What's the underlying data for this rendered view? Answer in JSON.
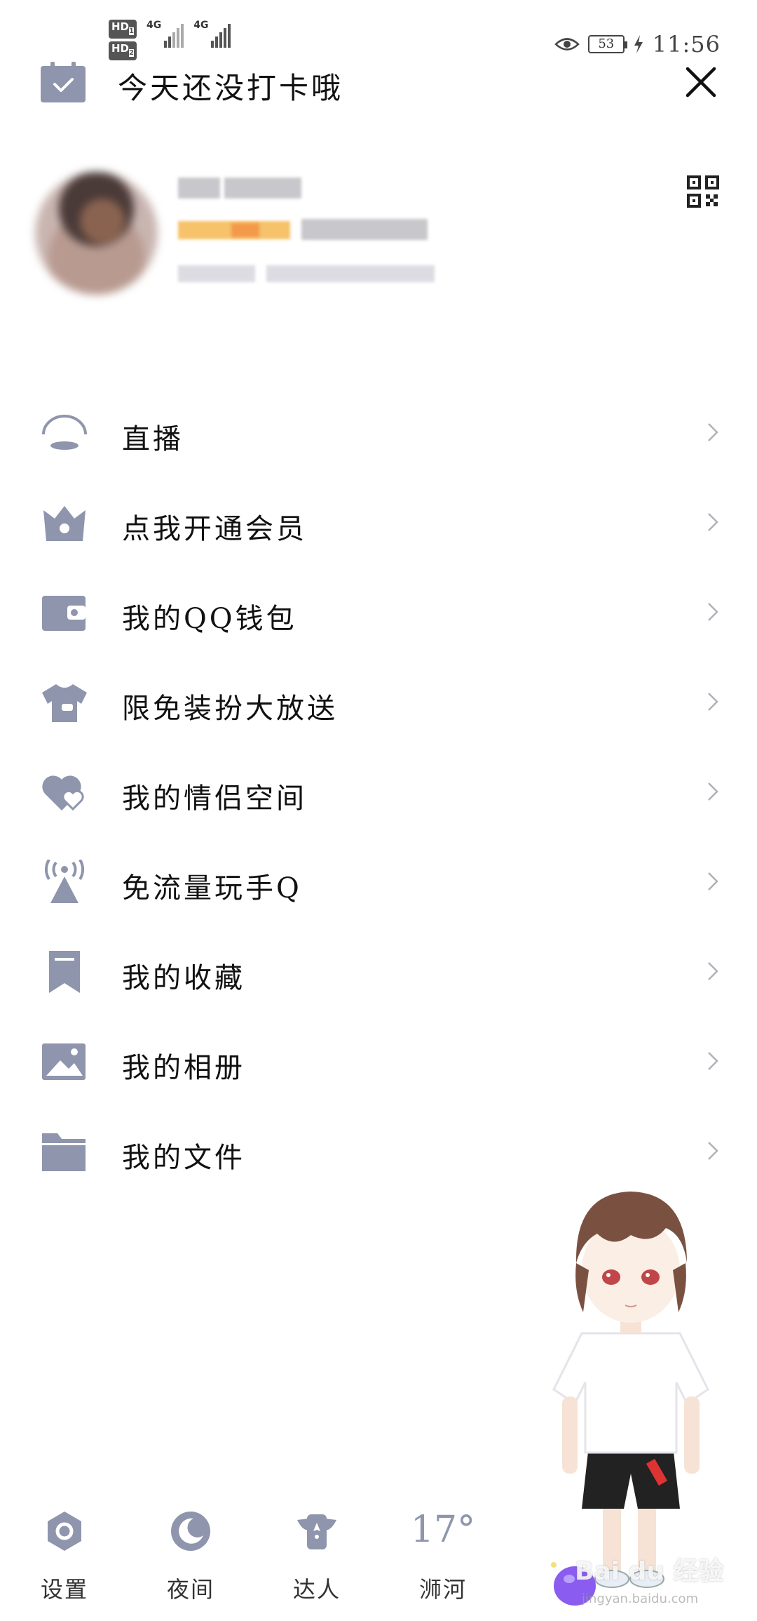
{
  "status_bar": {
    "sim1_badge": "HD",
    "sim2_badge": "HD",
    "sim1_index": "1",
    "sim2_index": "2",
    "network1": "4G",
    "network2": "4G",
    "battery_level": "53",
    "time": "11:56"
  },
  "header": {
    "checkin_text": "今天还没打卡哦",
    "checkin_icon": "calendar-check-icon",
    "close_icon": "close-icon",
    "qr_icon": "qr-code-icon"
  },
  "menu": {
    "items": [
      {
        "label": "直播",
        "icon": "live-icon"
      },
      {
        "label": "点我开通会员",
        "icon": "crown-icon"
      },
      {
        "label": "我的QQ钱包",
        "icon": "wallet-icon"
      },
      {
        "label": "限免装扮大放送",
        "icon": "tshirt-icon"
      },
      {
        "label": "我的情侣空间",
        "icon": "hearts-icon"
      },
      {
        "label": "免流量玩手Q",
        "icon": "signal-tower-icon"
      },
      {
        "label": "我的收藏",
        "icon": "bookmark-icon"
      },
      {
        "label": "我的相册",
        "icon": "image-icon"
      },
      {
        "label": "我的文件",
        "icon": "folder-icon"
      }
    ]
  },
  "bottom_bar": {
    "settings_label": "设置",
    "night_label": "夜间",
    "talent_label": "达人",
    "weather_temp": "17°",
    "weather_city": "浉河"
  },
  "watermark": {
    "text": "Bai du 经验",
    "sub": "jingyan.baidu.com"
  },
  "colors": {
    "icon": "#8e95ad",
    "text": "#111111",
    "chevron": "#b0b0b8",
    "background": "#ffffff"
  }
}
